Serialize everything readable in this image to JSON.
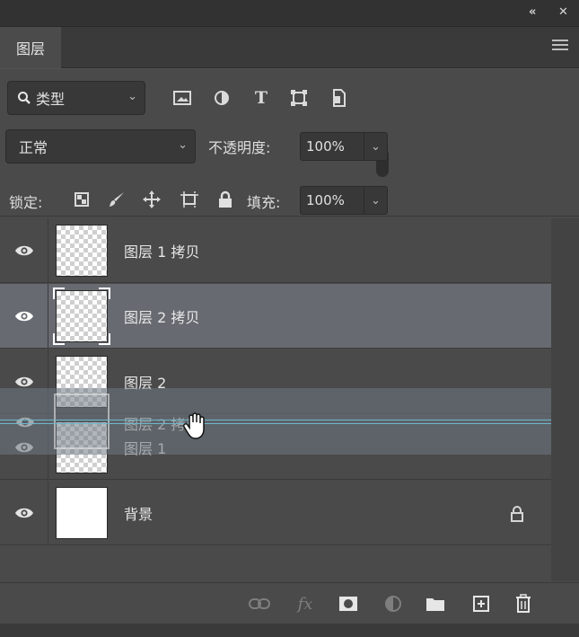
{
  "titlebar": {
    "collapse_glyph": "«",
    "close_glyph": "✕"
  },
  "tabs": [
    {
      "label": "图层",
      "active": true
    }
  ],
  "filter": {
    "kind_label": "类型",
    "icons": [
      "image-filter-icon",
      "adjustment-filter-icon",
      "type-filter-icon",
      "shape-filter-icon",
      "smart-object-filter-icon",
      "filter-toggle-icon"
    ]
  },
  "blend": {
    "mode": "正常",
    "opacity_label": "不透明度:",
    "opacity_value": "100%"
  },
  "lock": {
    "label": "锁定:",
    "fill_label": "填充:",
    "fill_value": "100%"
  },
  "layers": [
    {
      "name": "图层 1 拷贝",
      "visible": true,
      "selected": false
    },
    {
      "name": "图层 2 拷贝",
      "visible": true,
      "selected": true
    },
    {
      "name": "图层 2",
      "visible": true,
      "selected": false
    },
    {
      "name": "图层 1",
      "visible": true,
      "selected": false
    },
    {
      "name": "背景",
      "visible": true,
      "selected": false,
      "locked": true
    }
  ],
  "drag_ghost_name": "图层 2 拷贝",
  "colors": {
    "panel_bg": "#4a4a4a",
    "selected_row": "#676a70",
    "drop_line": "#6fb7cf"
  }
}
